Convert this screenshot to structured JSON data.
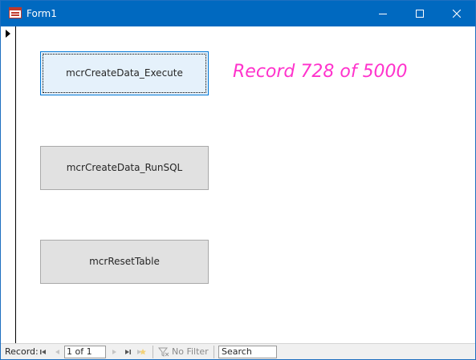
{
  "window": {
    "title": "Form1"
  },
  "form": {
    "buttons": [
      {
        "label": "mcrCreateData_Execute",
        "focused": true
      },
      {
        "label": "mcrCreateData_RunSQL",
        "focused": false
      },
      {
        "label": "mcrResetTable",
        "focused": false
      }
    ],
    "status_text": "Record 728 of 5000",
    "status_color": "#ff33cc"
  },
  "navigation": {
    "record_label": "Record:",
    "position_value": "1 of 1",
    "filter_label": "No Filter",
    "search_placeholder": "Search"
  },
  "colors": {
    "titlebar": "#0069c0",
    "button_face": "#e1e1e1",
    "focused_button_face": "#e5f1fb"
  }
}
